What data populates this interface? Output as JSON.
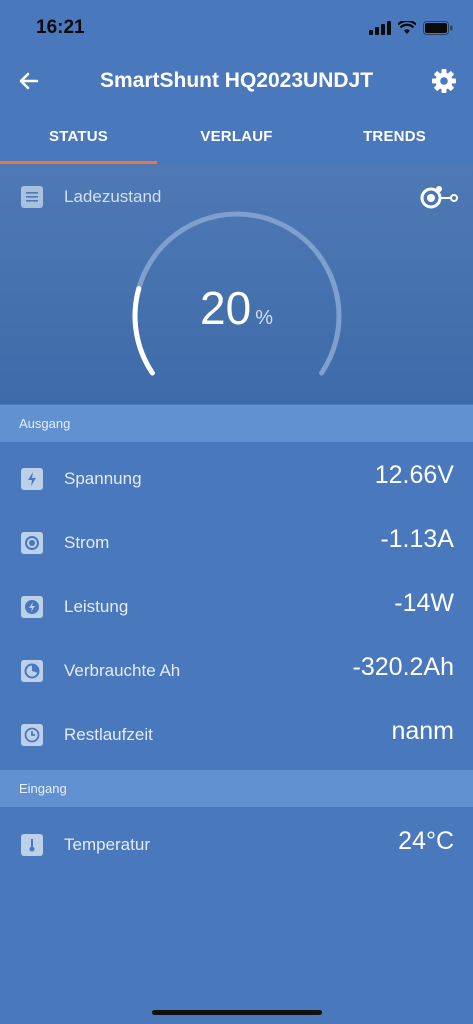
{
  "status_bar": {
    "time": "16:21"
  },
  "app_bar": {
    "title": "SmartShunt HQ2023UNDJT"
  },
  "tabs": [
    {
      "label": "STATUS",
      "active": true
    },
    {
      "label": "VERLAUF",
      "active": false
    },
    {
      "label": "TRENDS",
      "active": false
    }
  ],
  "gauge": {
    "label": "Ladezustand",
    "value": "20",
    "unit": "%",
    "fraction": 0.2
  },
  "sections": {
    "output": {
      "title": "Ausgang",
      "rows": [
        {
          "label": "Spannung",
          "value": "12.66V",
          "icon": "battery-bolt-icon"
        },
        {
          "label": "Strom",
          "value": "-1.13A",
          "icon": "current-icon"
        },
        {
          "label": "Leistung",
          "value": "-14W",
          "icon": "power-icon"
        },
        {
          "label": "Verbrauchte Ah",
          "value": "-320.2Ah",
          "icon": "consumed-icon"
        },
        {
          "label": "Restlaufzeit",
          "value": "nanm",
          "icon": "clock-icon"
        }
      ]
    },
    "input": {
      "title": "Eingang",
      "rows": [
        {
          "label": "Temperatur",
          "value": "24°C",
          "icon": "thermometer-icon"
        }
      ]
    }
  },
  "colors": {
    "background": "#4a78bd",
    "accent": "#f2733a",
    "section_header": "#6191d1"
  }
}
